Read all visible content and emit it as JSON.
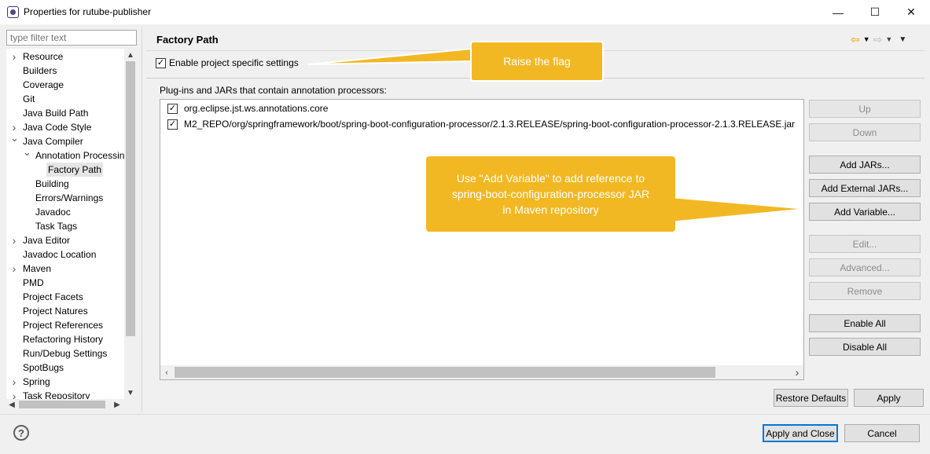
{
  "window": {
    "title": "Properties for rutube-publisher",
    "minimize": "—",
    "maximize": "☐",
    "close": "✕"
  },
  "sidebar": {
    "filter_placeholder": "type filter text",
    "items": [
      {
        "label": "Resource",
        "arrow": ">"
      },
      {
        "label": "Builders",
        "arrow": ""
      },
      {
        "label": "Coverage",
        "arrow": ""
      },
      {
        "label": "Git",
        "arrow": ""
      },
      {
        "label": "Java Build Path",
        "arrow": ""
      },
      {
        "label": "Java Code Style",
        "arrow": ">"
      },
      {
        "label": "Java Compiler",
        "arrow": "v"
      },
      {
        "label": "Annotation Processin",
        "arrow": "v"
      },
      {
        "label": "Factory Path",
        "arrow": ""
      },
      {
        "label": "Building",
        "arrow": ""
      },
      {
        "label": "Errors/Warnings",
        "arrow": ""
      },
      {
        "label": "Javadoc",
        "arrow": ""
      },
      {
        "label": "Task Tags",
        "arrow": ""
      },
      {
        "label": "Java Editor",
        "arrow": ">"
      },
      {
        "label": "Javadoc Location",
        "arrow": ""
      },
      {
        "label": "Maven",
        "arrow": ">"
      },
      {
        "label": "PMD",
        "arrow": ""
      },
      {
        "label": "Project Facets",
        "arrow": ""
      },
      {
        "label": "Project Natures",
        "arrow": ""
      },
      {
        "label": "Project References",
        "arrow": ""
      },
      {
        "label": "Refactoring History",
        "arrow": ""
      },
      {
        "label": "Run/Debug Settings",
        "arrow": ""
      },
      {
        "label": "SpotBugs",
        "arrow": ""
      },
      {
        "label": "Spring",
        "arrow": ">"
      },
      {
        "label": "Task Repository",
        "arrow": ">"
      }
    ]
  },
  "page": {
    "title": "Factory Path",
    "enable_specific": "Enable project specific settings",
    "plugins_label": "Plug-ins and JARs that contain annotation processors:",
    "entries": [
      "org.eclipse.jst.ws.annotations.core",
      "M2_REPO/org/springframework/boot/spring-boot-configuration-processor/2.1.3.RELEASE/spring-boot-configuration-processor-2.1.3.RELEASE.jar"
    ],
    "buttons": {
      "up": "Up",
      "down": "Down",
      "add_jars": "Add JARs...",
      "add_external_jars": "Add External JARs...",
      "add_variable": "Add Variable...",
      "edit": "Edit...",
      "advanced": "Advanced...",
      "remove": "Remove",
      "enable_all": "Enable All",
      "disable_all": "Disable All"
    },
    "restore_defaults": "Restore Defaults",
    "apply": "Apply"
  },
  "footer": {
    "help": "?",
    "apply_close": "Apply and Close",
    "cancel": "Cancel"
  },
  "callouts": {
    "flag": "Raise the flag",
    "variable_line1": "Use \"Add Variable\" to add reference to",
    "variable_line2": "spring-boot-configuration-processor JAR",
    "variable_line3": "in Maven repository"
  },
  "colors": {
    "callout": "#f2b824",
    "nav_back": "#e8a200",
    "primary_border": "#0078d7"
  }
}
